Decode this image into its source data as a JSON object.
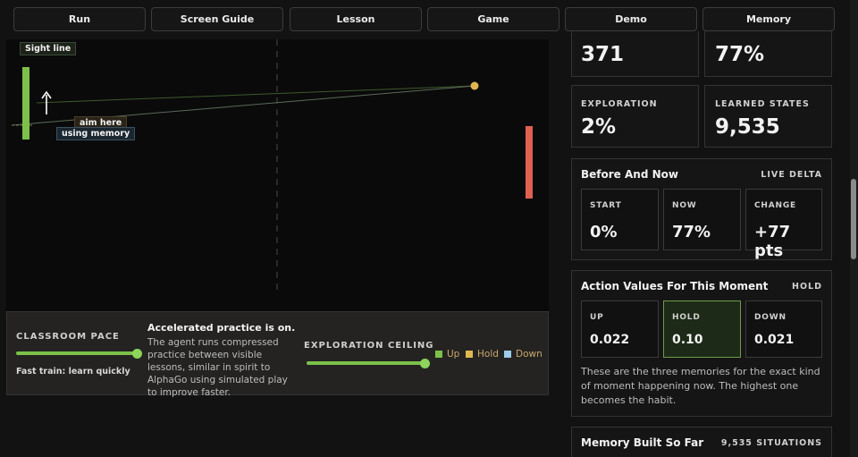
{
  "tabs": [
    "Run",
    "Screen Guide",
    "Lesson",
    "Game",
    "Demo",
    "Memory"
  ],
  "game": {
    "sight_line_label": "Sight line",
    "aim_label": "aim here",
    "memory_label": "using memory",
    "colors": {
      "left_paddle": "#7cc04a",
      "right_paddle": "#e0614f",
      "ball": "#e0b64f"
    }
  },
  "controls": {
    "pace_label": "CLASSROOM PACE",
    "pace_note": "Fast train: learn quickly",
    "pace_level": 1.0,
    "info_title": "Accelerated practice is on.",
    "info_text": "The agent runs compressed practice between visible lessons, similar in spirit to AlphaGo using simulated play to improve faster.",
    "exploration_label": "EXPLORATION CEILING",
    "exploration_level": 1.0,
    "legend": [
      {
        "label": "Up",
        "color": "#7cc04a"
      },
      {
        "label": "Hold",
        "color": "#e0b64f"
      },
      {
        "label": "Down",
        "color": "#9ecbe8"
      }
    ]
  },
  "stats": {
    "top_left_value": "371",
    "top_right_value": "77%",
    "exploration_label": "EXPLORATION",
    "exploration_value": "2%",
    "learned_label": "LEARNED STATES",
    "learned_value": "9,535"
  },
  "before_now": {
    "title": "Before And Now",
    "badge": "LIVE DELTA",
    "start_label": "START",
    "start_value": "0%",
    "now_label": "NOW",
    "now_value": "77%",
    "change_label": "CHANGE",
    "change_value": "+77 pts"
  },
  "action_values": {
    "title": "Action Values For This Moment",
    "badge": "HOLD",
    "up_label": "UP",
    "up_value": "0.022",
    "hold_label": "HOLD",
    "hold_value": "0.10",
    "down_label": "DOWN",
    "down_value": "0.021",
    "note": "These are the three memories for the exact kind of moment happening now. The highest one becomes the habit."
  },
  "memory": {
    "title": "Memory Built So Far",
    "badge": "9,535 SITUATIONS"
  }
}
